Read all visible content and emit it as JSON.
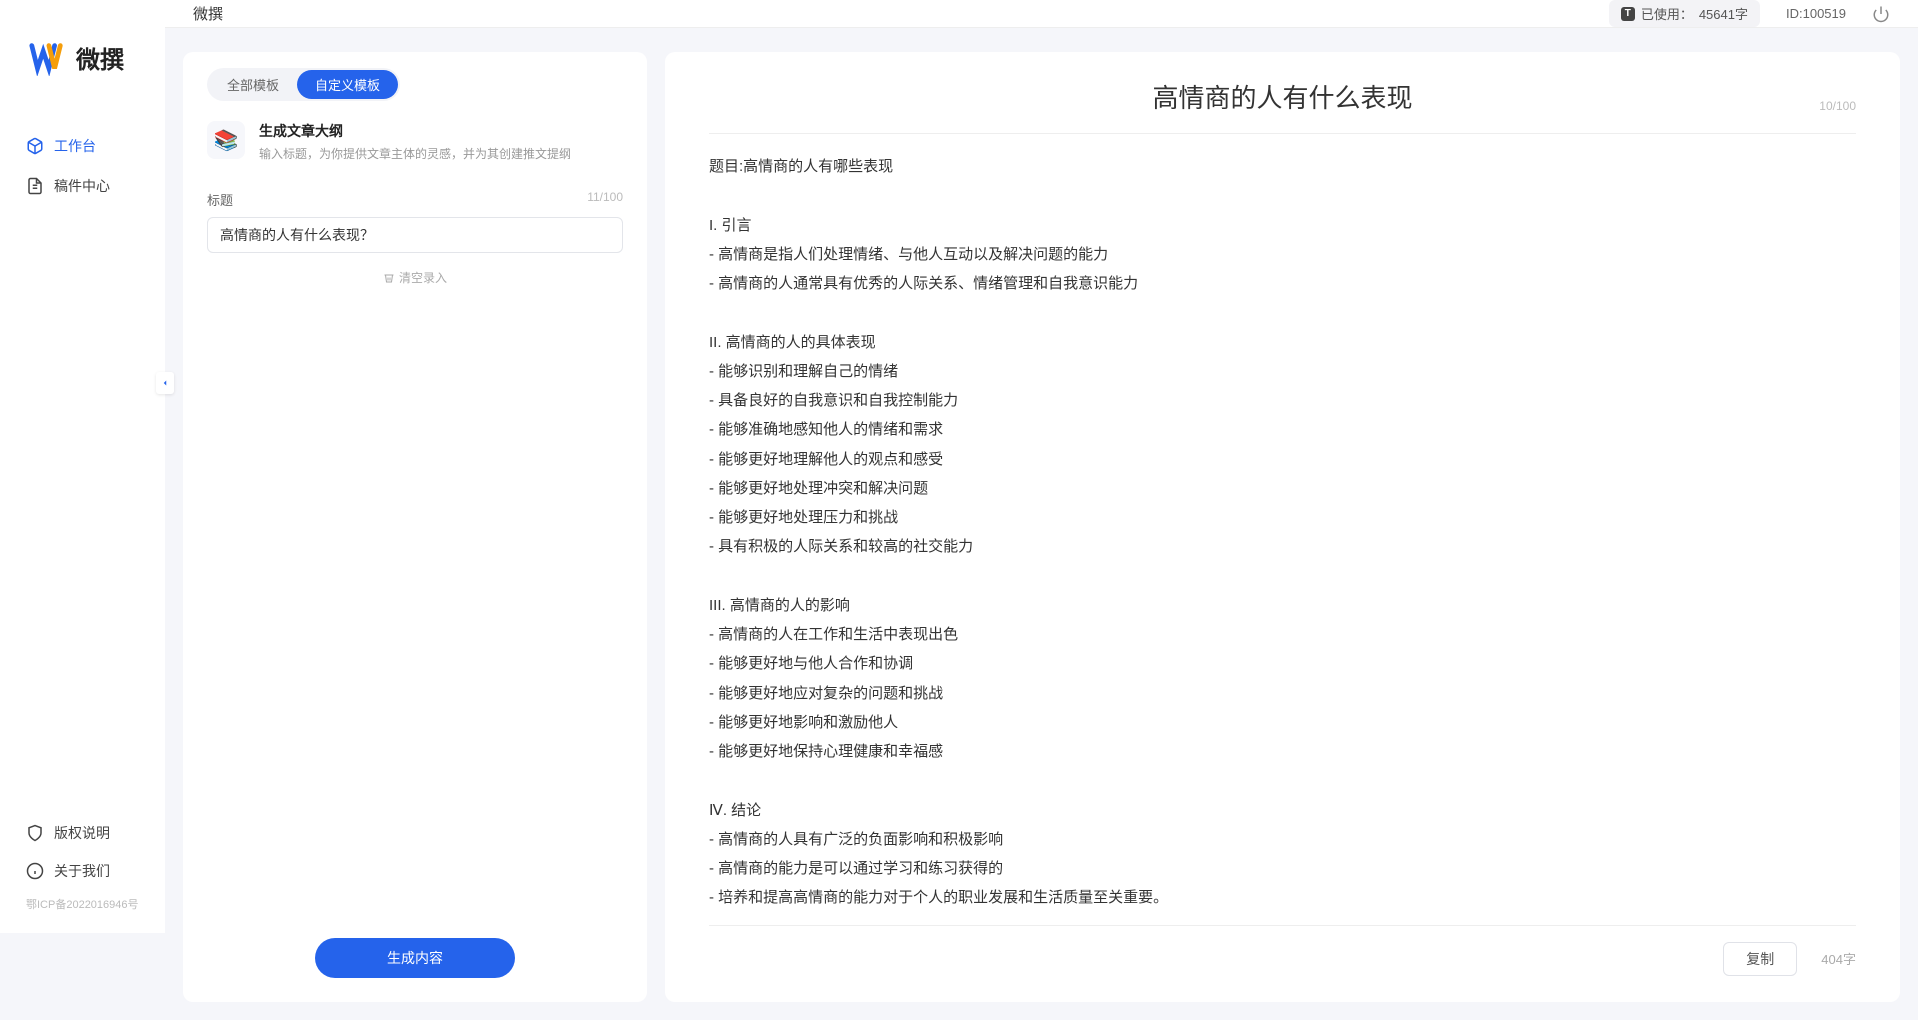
{
  "brand": {
    "name": "微撰"
  },
  "topbar": {
    "title": "微撰",
    "usage_label": "已使用：",
    "usage_value": "45641字",
    "user_id_label": "ID:",
    "user_id": "100519"
  },
  "sidebar": {
    "nav": [
      {
        "label": "工作台",
        "active": true,
        "icon": "cube"
      },
      {
        "label": "稿件中心",
        "active": false,
        "icon": "doc"
      }
    ],
    "bottom": [
      {
        "label": "版权说明",
        "icon": "shield"
      },
      {
        "label": "关于我们",
        "icon": "info"
      }
    ],
    "icp": "鄂ICP备2022016946号"
  },
  "left_panel": {
    "tabs": [
      {
        "label": "全部模板",
        "active": false
      },
      {
        "label": "自定义模板",
        "active": true
      }
    ],
    "template": {
      "title": "生成文章大纲",
      "desc": "输入标题，为你提供文章主体的灵感，并为其创建推文提纲"
    },
    "field": {
      "label": "标题",
      "count": "11/100",
      "value": "高情商的人有什么表现？"
    },
    "clear_label": "清空录入",
    "generate_label": "生成内容"
  },
  "output": {
    "title": "高情商的人有什么表现",
    "title_count": "10/100",
    "body": "题目:高情商的人有哪些表现\n\nI. 引言\n- 高情商是指人们处理情绪、与他人互动以及解决问题的能力\n- 高情商的人通常具有优秀的人际关系、情绪管理和自我意识能力\n\nII. 高情商的人的具体表现\n- 能够识别和理解自己的情绪\n- 具备良好的自我意识和自我控制能力\n- 能够准确地感知他人的情绪和需求\n- 能够更好地理解他人的观点和感受\n- 能够更好地处理冲突和解决问题\n- 能够更好地处理压力和挑战\n- 具有积极的人际关系和较高的社交能力\n\nIII. 高情商的人的影响\n- 高情商的人在工作和生活中表现出色\n- 能够更好地与他人合作和协调\n- 能够更好地应对复杂的问题和挑战\n- 能够更好地影响和激励他人\n- 能够更好地保持心理健康和幸福感\n\nⅣ. 结论\n- 高情商的人具有广泛的负面影响和积极影响\n- 高情商的能力是可以通过学习和练习获得的\n- 培养和提高高情商的能力对于个人的职业发展和生活质量至关重要。",
    "copy_label": "复制",
    "word_count": "404字"
  }
}
